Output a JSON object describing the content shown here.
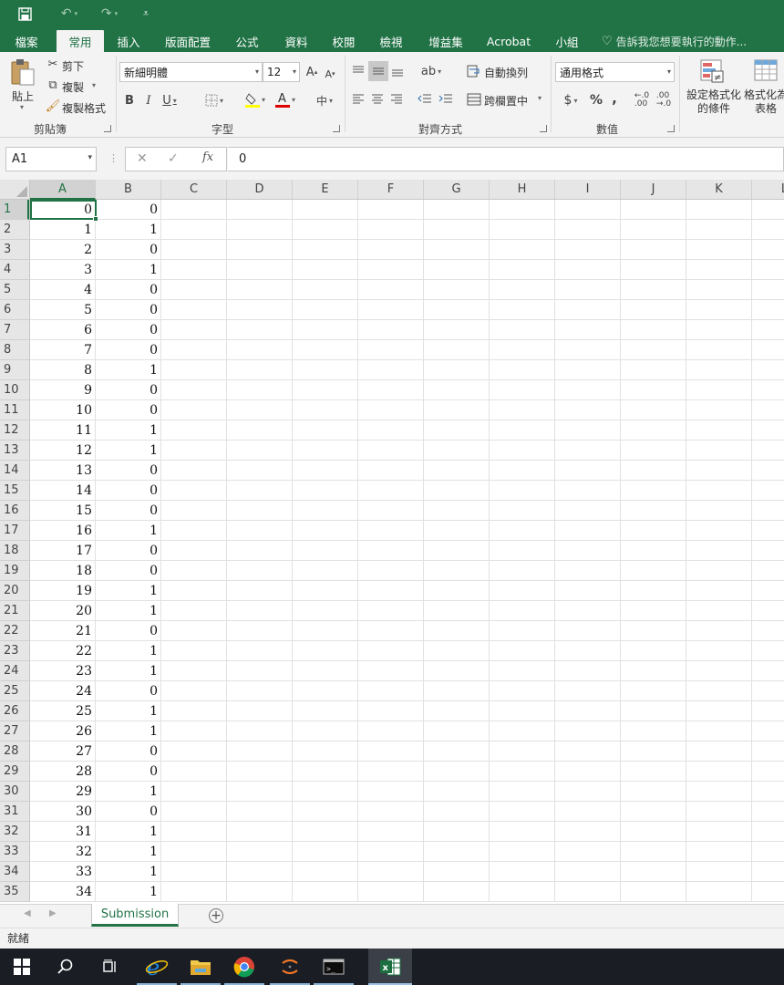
{
  "ribbon_tabs": [
    "檔案",
    "常用",
    "插入",
    "版面配置",
    "公式",
    "資料",
    "校閱",
    "檢視",
    "增益集",
    "Acrobat",
    "小組"
  ],
  "active_tab": "常用",
  "tell_me": "告訴我您想要執行的動作...",
  "clipboard": {
    "paste": "貼上",
    "cut": "剪下",
    "copy": "複製",
    "format_painter": "複製格式",
    "group": "剪貼簿"
  },
  "font": {
    "name": "新細明體",
    "size": "12",
    "group": "字型"
  },
  "alignment": {
    "wrap_text": "自動換列",
    "merge_center": "跨欄置中",
    "group": "對齊方式"
  },
  "number": {
    "format": "通用格式",
    "group": "數值"
  },
  "styles": {
    "conditional_formatting": "設定格式化的條件",
    "format_as_table": "格式化為表格"
  },
  "name_box": "A1",
  "formula_value": "0",
  "columns": [
    "A",
    "B",
    "C",
    "D",
    "E",
    "F",
    "G",
    "H",
    "I",
    "J",
    "K",
    "L"
  ],
  "rows": [
    [
      "0",
      "0"
    ],
    [
      "1",
      "1"
    ],
    [
      "2",
      "0"
    ],
    [
      "3",
      "1"
    ],
    [
      "4",
      "0"
    ],
    [
      "5",
      "0"
    ],
    [
      "6",
      "0"
    ],
    [
      "7",
      "0"
    ],
    [
      "8",
      "1"
    ],
    [
      "9",
      "0"
    ],
    [
      "10",
      "0"
    ],
    [
      "11",
      "1"
    ],
    [
      "12",
      "1"
    ],
    [
      "13",
      "0"
    ],
    [
      "14",
      "0"
    ],
    [
      "15",
      "0"
    ],
    [
      "16",
      "1"
    ],
    [
      "17",
      "0"
    ],
    [
      "18",
      "0"
    ],
    [
      "19",
      "1"
    ],
    [
      "20",
      "1"
    ],
    [
      "21",
      "0"
    ],
    [
      "22",
      "1"
    ],
    [
      "23",
      "1"
    ],
    [
      "24",
      "0"
    ],
    [
      "25",
      "1"
    ],
    [
      "26",
      "1"
    ],
    [
      "27",
      "0"
    ],
    [
      "28",
      "0"
    ],
    [
      "29",
      "1"
    ],
    [
      "30",
      "0"
    ],
    [
      "31",
      "1"
    ],
    [
      "32",
      "1"
    ],
    [
      "33",
      "1"
    ],
    [
      "34",
      "1"
    ]
  ],
  "row_numbers": [
    "1",
    "2",
    "3",
    "4",
    "5",
    "6",
    "7",
    "8",
    "9",
    "10",
    "11",
    "12",
    "13",
    "14",
    "15",
    "16",
    "17",
    "18",
    "19",
    "20",
    "21",
    "22",
    "23",
    "24",
    "25",
    "26",
    "27",
    "28",
    "29",
    "30",
    "31",
    "32",
    "33",
    "34",
    "35"
  ],
  "sheet_tab": "Submission",
  "status": "就緒",
  "colors": {
    "excel_green": "#217346",
    "taskbar": "#1a1d24"
  }
}
